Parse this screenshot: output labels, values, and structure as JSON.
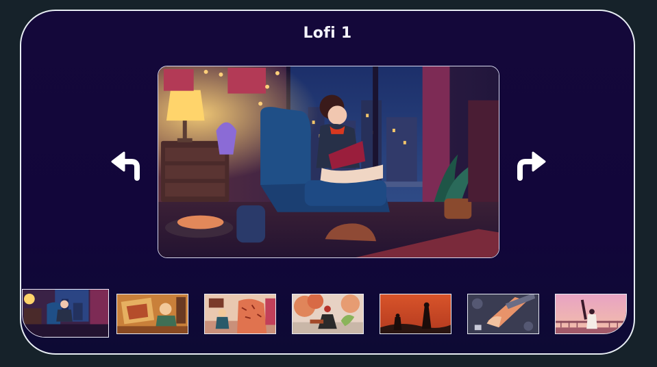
{
  "title": "Lofi 1",
  "navigation": {
    "prev_icon": "turn-left-arrow-icon",
    "next_icon": "turn-right-arrow-icon"
  },
  "main_image": {
    "subject": "lofi-girl-reading-in-armchair"
  },
  "thumbnails": [
    {
      "subject": "lofi-girl-reading",
      "active": true
    },
    {
      "subject": "map-and-desk-illustration",
      "active": false
    },
    {
      "subject": "tiger-and-kid-room",
      "active": false
    },
    {
      "subject": "red-haired-girl-autumn-garden",
      "active": false
    },
    {
      "subject": "silhouettes-orange-sky",
      "active": false
    },
    {
      "subject": "hand-with-sword-dark",
      "active": false
    },
    {
      "subject": "girl-with-guitar-pink-sunset",
      "active": false
    }
  ],
  "colors": {
    "page_background": "#16222a",
    "frame_background": "#14083a",
    "frame_border": "#e8eef4",
    "title_text": "#f4f4fb"
  }
}
